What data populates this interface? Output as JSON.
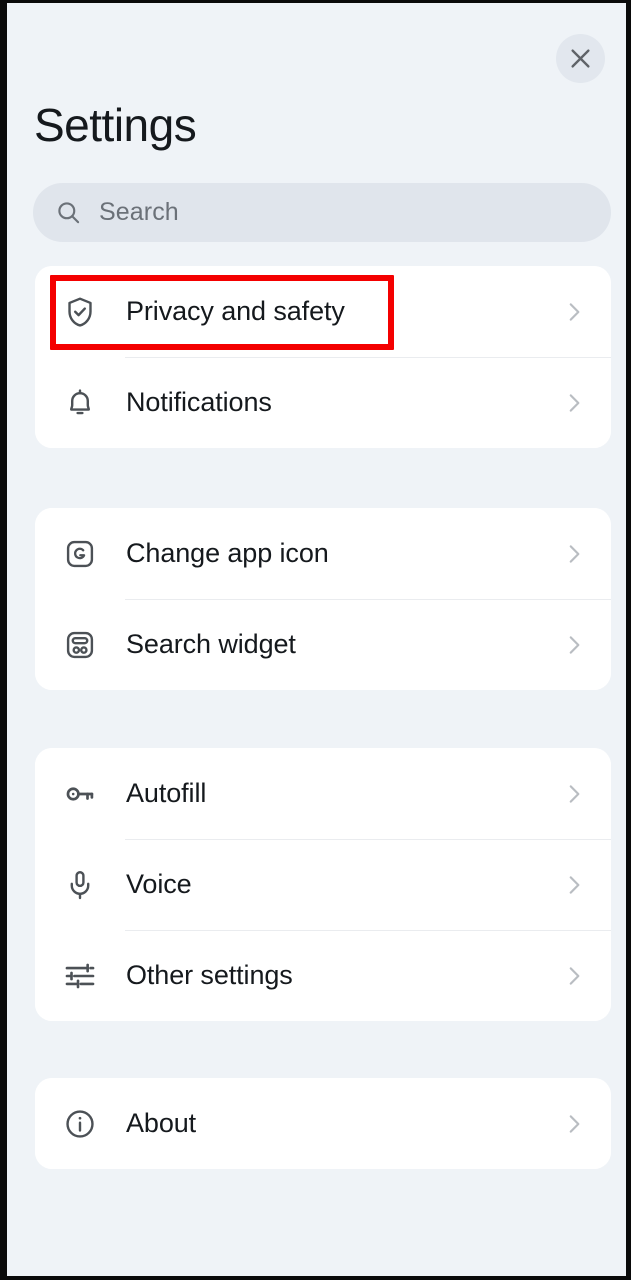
{
  "window": {
    "background_color": "#eff3f7",
    "card_color": "#ffffff",
    "frame_color": "#0a0a0a"
  },
  "header": {
    "title": "Settings",
    "close_button": {
      "label": "Close",
      "icon": "close-icon"
    }
  },
  "search": {
    "placeholder": "Search",
    "value": "",
    "icon": "search-icon"
  },
  "annotation": {
    "type": "highlight-rectangle",
    "color": "#f40000",
    "targets": "Privacy and safety"
  },
  "groups": [
    {
      "id": "group-privacy",
      "items": [
        {
          "label": "Privacy and safety",
          "icon": "shield-check-icon",
          "chevron": "chevron-right-icon",
          "highlighted": true
        },
        {
          "label": "Notifications",
          "icon": "bell-icon",
          "chevron": "chevron-right-icon",
          "highlighted": false
        }
      ]
    },
    {
      "id": "group-appearance",
      "items": [
        {
          "label": "Change app icon",
          "icon": "app-icon-g-icon",
          "chevron": "chevron-right-icon",
          "highlighted": false
        },
        {
          "label": "Search widget",
          "icon": "widget-icon",
          "chevron": "chevron-right-icon",
          "highlighted": false
        }
      ]
    },
    {
      "id": "group-input",
      "items": [
        {
          "label": "Autofill",
          "icon": "key-icon",
          "chevron": "chevron-right-icon",
          "highlighted": false
        },
        {
          "label": "Voice",
          "icon": "microphone-icon",
          "chevron": "chevron-right-icon",
          "highlighted": false
        },
        {
          "label": "Other settings",
          "icon": "tune-sliders-icon",
          "chevron": "chevron-right-icon",
          "highlighted": false
        }
      ]
    },
    {
      "id": "group-info",
      "items": [
        {
          "label": "About",
          "icon": "info-circle-icon",
          "chevron": "chevron-right-icon",
          "highlighted": false
        }
      ]
    }
  ]
}
